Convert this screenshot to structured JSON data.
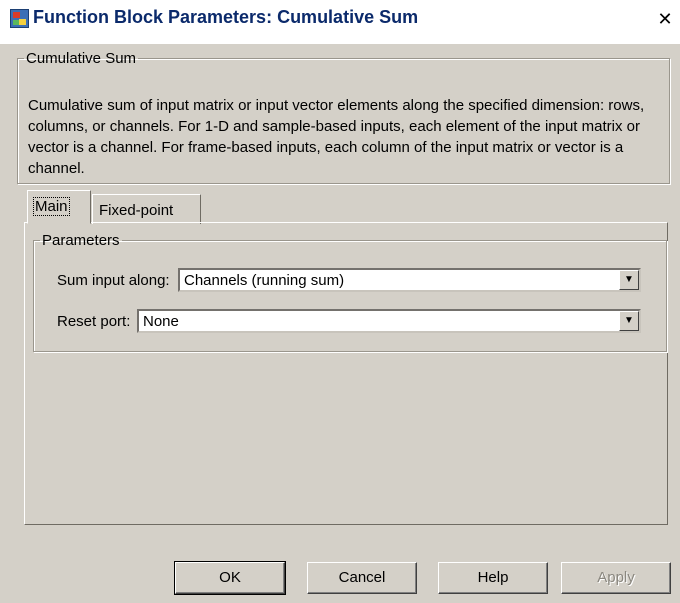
{
  "window": {
    "title": "Function Block Parameters: Cumulative Sum",
    "close_symbol": "✕"
  },
  "description": {
    "legend": "Cumulative Sum",
    "text": "Cumulative sum of input matrix or input vector elements along the specified dimension: rows, columns, or channels.  For 1-D and sample-based inputs, each element of the input matrix or vector is a channel.  For frame-based inputs, each column of the input matrix or vector is a channel."
  },
  "tabs": [
    {
      "label": "Main",
      "active": true
    },
    {
      "label": "Fixed-point",
      "active": false
    }
  ],
  "parameters": {
    "legend": "Parameters",
    "sum_input_along": {
      "label": "Sum input along:",
      "value": "Channels (running sum)"
    },
    "reset_port": {
      "label": "Reset port:",
      "value": "None"
    }
  },
  "buttons": {
    "ok": "OK",
    "cancel": "Cancel",
    "help": "Help",
    "apply": "Apply"
  },
  "icons": {
    "dropdown": "chevron-down-icon",
    "app": "simulink-block-icon",
    "close": "close-icon"
  }
}
